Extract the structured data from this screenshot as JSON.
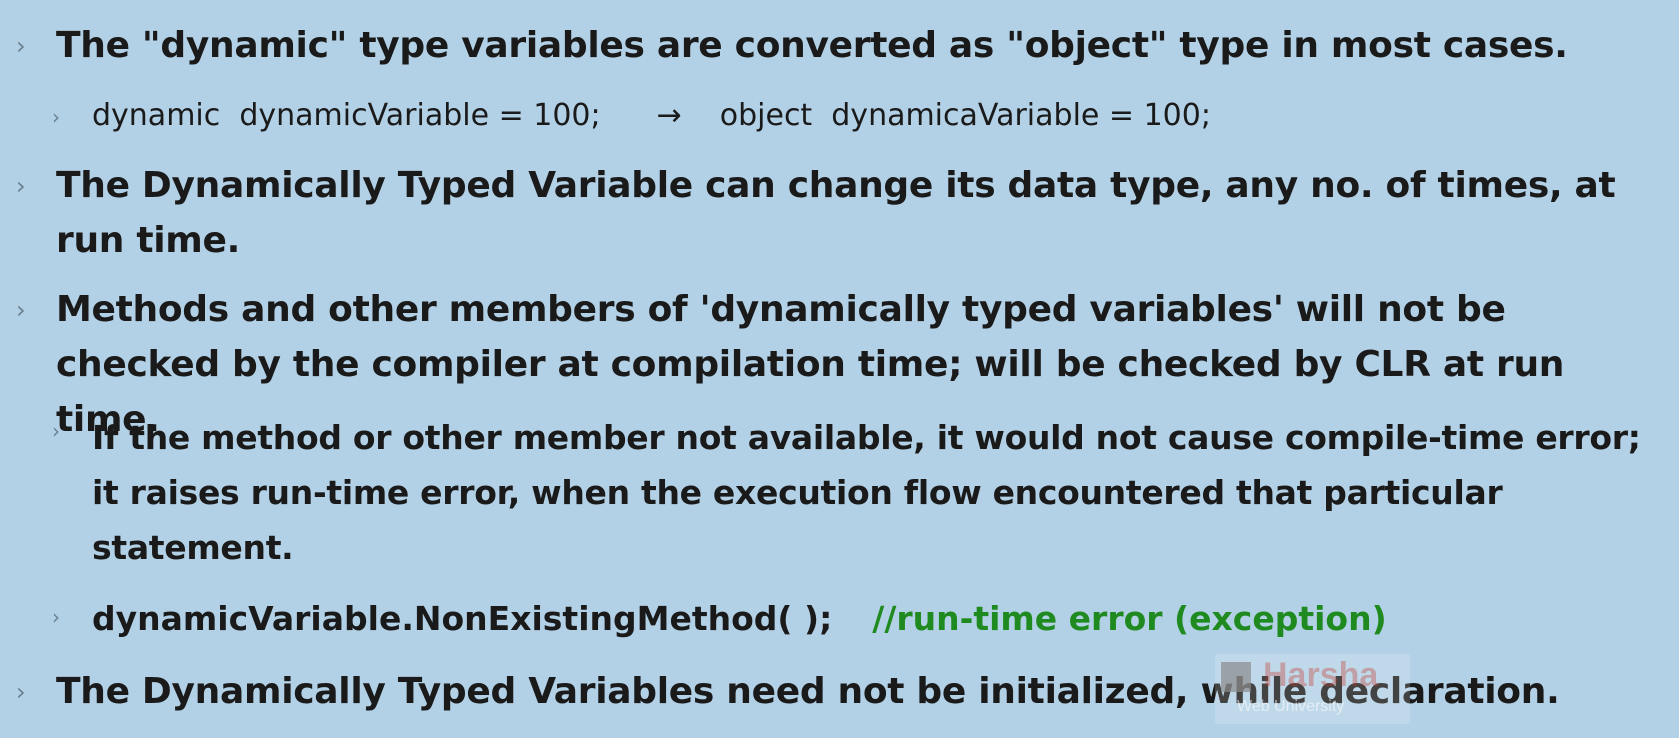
{
  "bullets": {
    "b1": "The \"dynamic\" type variables are converted as \"object\" type in most cases.",
    "b1_code_left": "dynamic  dynamicVariable = 100;",
    "b1_code_arrow": "→",
    "b1_code_right": "object  dynamicaVariable = 100;",
    "b2": "The Dynamically Typed Variable can change its data type, any no. of times, at run time.",
    "b3": "Methods and other members of 'dynamically typed variables' will not be checked by the compiler at compilation time; will be checked by CLR at run time.",
    "b3_sub1": "If the method or other member not available, it would not cause compile-time error; it raises run-time error, when the execution flow encountered that particular statement.",
    "b3_sub2_code": "dynamicVariable.NonExistingMethod( );",
    "b3_sub2_comment": "//run-time error (exception)",
    "b4": "The Dynamically Typed Variables need not be initialized, while declaration."
  },
  "bullet_glyph": "›",
  "watermark": {
    "title": "Harsha",
    "subtitle": "Web University"
  },
  "colors": {
    "background": "#b3d1e6",
    "text": "#1a1a1a",
    "comment": "#1f8a1f",
    "bullet": "#6a7f8e"
  }
}
